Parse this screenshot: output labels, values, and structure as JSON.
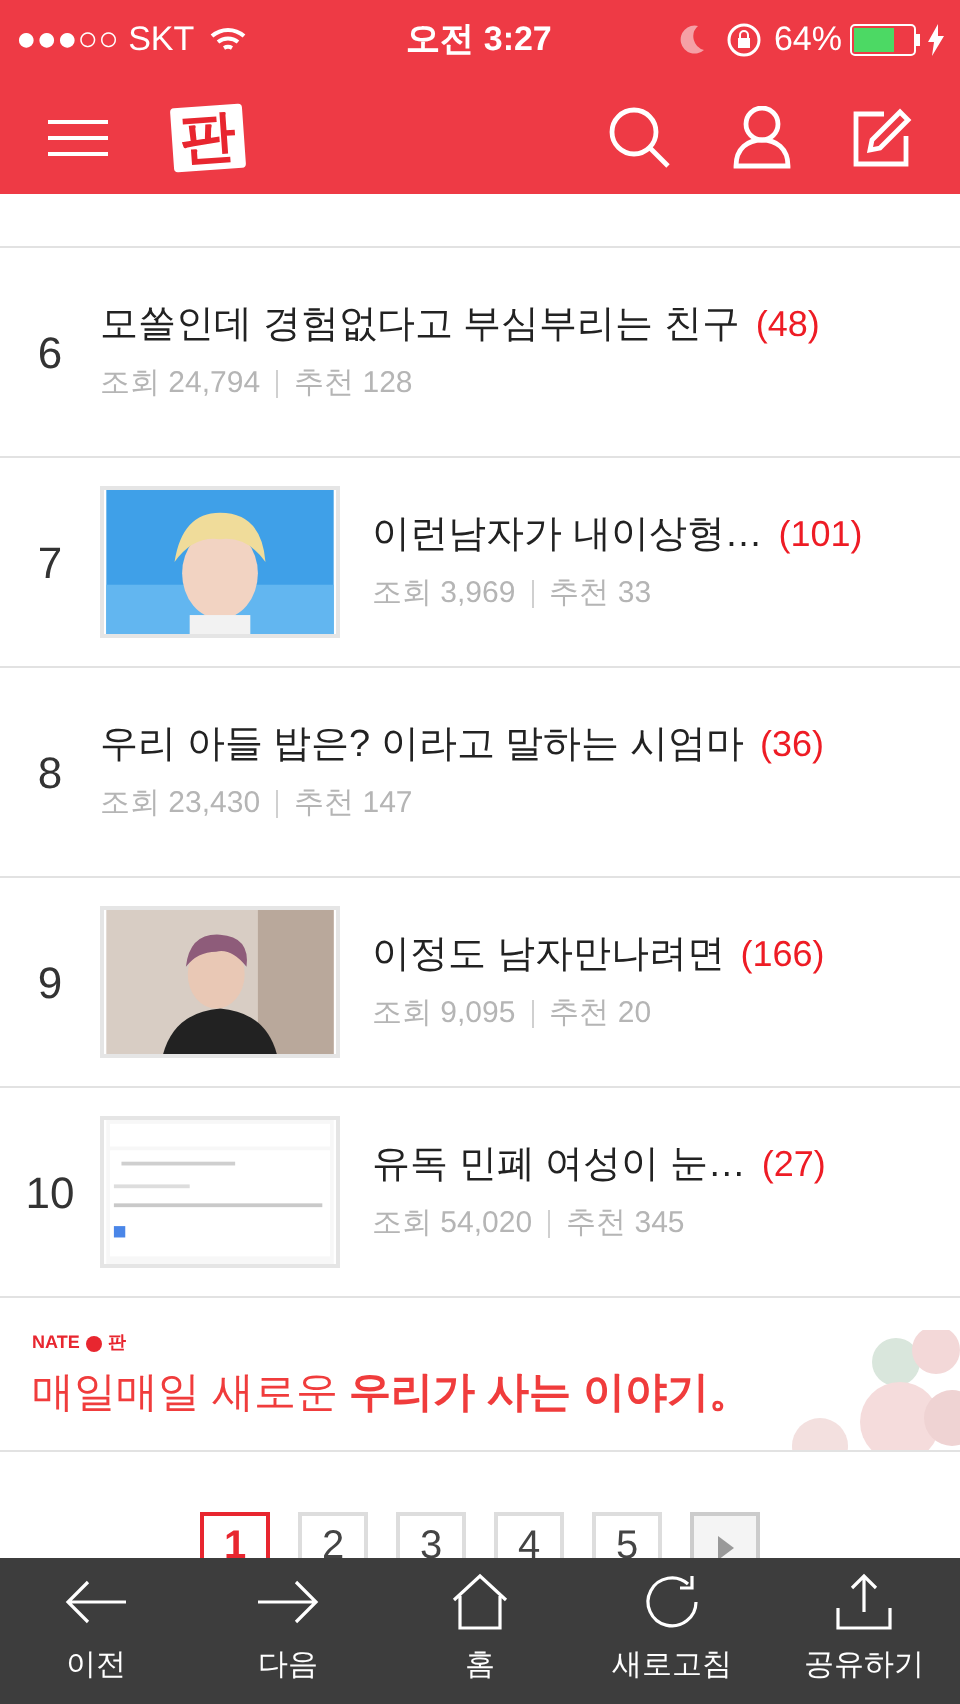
{
  "status_bar": {
    "carrier": "●●●○○ SKT",
    "time": "오전 3:27",
    "battery": "64%"
  },
  "header": {
    "logo": "판"
  },
  "posts": [
    {
      "rank": "6",
      "title": "모쏠인데 경험없다고 부심부리는 친구",
      "comments": "(48)",
      "views_label": "조회",
      "views": "24,794",
      "likes_label": "추천",
      "likes": "128"
    },
    {
      "rank": "7",
      "title": "이런남자가 내이상형…",
      "comments": "(101)",
      "views_label": "조회",
      "views": "3,969",
      "likes_label": "추천",
      "likes": "33"
    },
    {
      "rank": "8",
      "title": "우리 아들 밥은? 이라고 말하는 시엄마",
      "comments": "(36)",
      "views_label": "조회",
      "views": "23,430",
      "likes_label": "추천",
      "likes": "147"
    },
    {
      "rank": "9",
      "title": "이정도 남자만나려면",
      "comments": "(166)",
      "views_label": "조회",
      "views": "9,095",
      "likes_label": "추천",
      "likes": "20"
    },
    {
      "rank": "10",
      "title": "유독 민폐 여성이 눈…",
      "comments": "(27)",
      "views_label": "조회",
      "views": "54,020",
      "likes_label": "추천",
      "likes": "345"
    }
  ],
  "banner": {
    "brand": "NATE",
    "brand_sub": "판",
    "text": "매일매일 새로운 **우리가 사는 이야기。**"
  },
  "pagination": [
    {
      "label": "1",
      "selected": true
    },
    {
      "label": "2",
      "selected": false
    },
    {
      "label": "3",
      "selected": false
    },
    {
      "label": "4",
      "selected": false
    },
    {
      "label": "5",
      "selected": false
    }
  ],
  "toolbar": [
    {
      "kind": "back",
      "label": "이전"
    },
    {
      "kind": "forward",
      "label": "다음"
    },
    {
      "kind": "home",
      "label": "홈"
    },
    {
      "kind": "refresh",
      "label": "새로고침"
    },
    {
      "kind": "share",
      "label": "공유하기"
    }
  ]
}
